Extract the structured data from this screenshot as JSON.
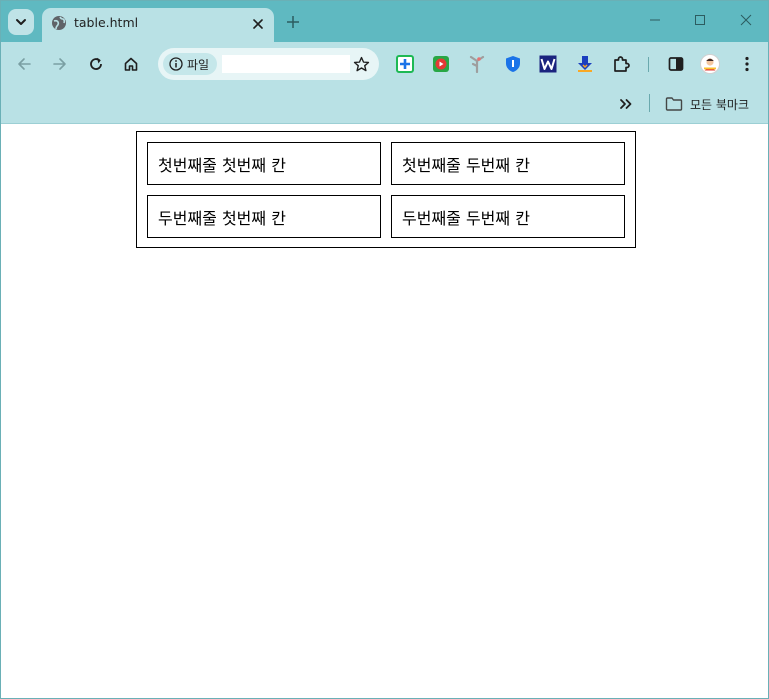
{
  "browser": {
    "tab": {
      "title": "table.html",
      "favicon": "globe-icon"
    },
    "new_tab_icon": "plus-icon",
    "window_controls": [
      "minimize-icon",
      "maximize-icon",
      "close-icon"
    ]
  },
  "toolbar": {
    "back_icon": "arrow-left-icon",
    "forward_icon": "arrow-right-icon",
    "reload_icon": "reload-icon",
    "home_icon": "home-icon",
    "site_info_label": "파일",
    "url_value": "",
    "extensions": [
      "green-plus-extension-icon",
      "youtube-extension-icon",
      "grey-figure-extension-icon",
      "shield-extension-icon",
      "w-extension-icon",
      "download-arrow-extension-icon",
      "puzzle-icon"
    ],
    "side_panel_icon": "side-panel-icon",
    "profile_icon": "avatar",
    "menu_icon": "kebab-menu-icon"
  },
  "bookmarks_bar": {
    "overflow_icon": "double-chevron-icon",
    "folder_label": "모든 북마크"
  },
  "table": {
    "rows": [
      [
        "첫번째줄 첫번째 칸",
        "첫번째줄 두번째 칸"
      ],
      [
        "두번째줄 첫번째 칸",
        "두번째줄 두번째 칸"
      ]
    ]
  },
  "colors": {
    "tabstrip": "#5fb9c1",
    "toolbar": "#b9e1e5",
    "omnibox": "#e7f5f6"
  }
}
